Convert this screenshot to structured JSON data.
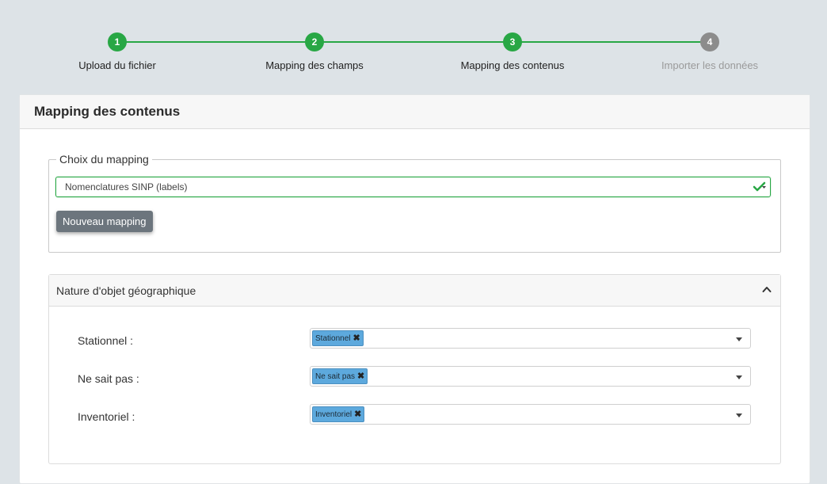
{
  "stepper": {
    "steps": [
      {
        "number": "1",
        "label": "Upload du fichier",
        "state": "done"
      },
      {
        "number": "2",
        "label": "Mapping des champs",
        "state": "done"
      },
      {
        "number": "3",
        "label": "Mapping des contenus",
        "state": "current"
      },
      {
        "number": "4",
        "label": "Importer les données",
        "state": "pending"
      }
    ]
  },
  "card": {
    "title": "Mapping des contenus"
  },
  "mapping_choice": {
    "legend": "Choix du mapping",
    "selected_value": "Nomenclatures SINP (labels)",
    "new_button_label": "Nouveau mapping"
  },
  "panel": {
    "title": "Nature d'objet géographique",
    "rows": [
      {
        "label": "Stationnel :",
        "tag": "Stationnel"
      },
      {
        "label": "Ne sait pas :",
        "tag": "Ne sait pas"
      },
      {
        "label": "Inventoriel :",
        "tag": "Inventoriel"
      }
    ]
  },
  "colors": {
    "accent_green": "#28a745",
    "inactive_gray": "#8c8c8c",
    "tag_blue": "#5da9dd",
    "button_gray": "#6c757d"
  },
  "icons": {
    "valid": "check-icon",
    "collapse": "chevron-up-icon",
    "dropdown": "caret-down-icon",
    "remove_tag": "close-icon"
  }
}
